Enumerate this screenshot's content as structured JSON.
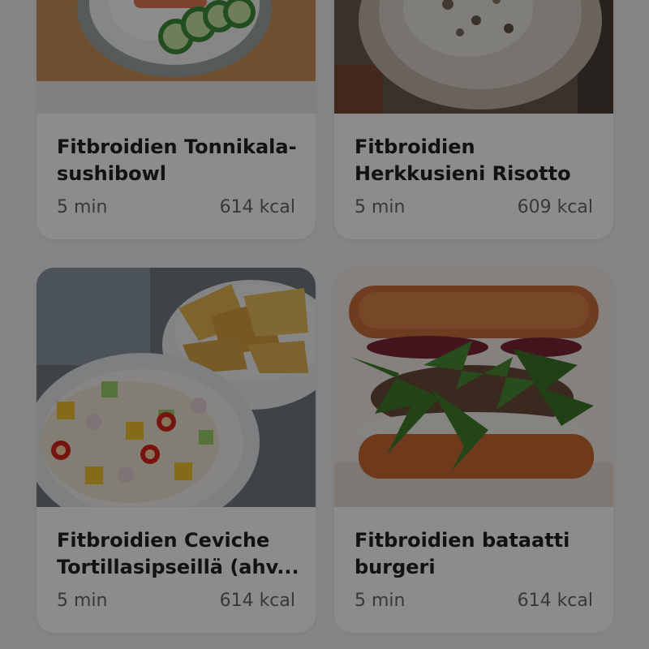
{
  "recipes": [
    {
      "title_line1": "Fitbroidien Tonnikala-",
      "title_line2": "sushibowl",
      "time": "5 min",
      "kcal": "614 kcal"
    },
    {
      "title_line1": "Fitbroidien",
      "title_line2": "Herkkusieni Risotto",
      "time": "5 min",
      "kcal": "609 kcal"
    },
    {
      "title_line1": "Fitbroidien Ceviche",
      "title_line2": "Tortillasipseillä (ahv...",
      "time": "5 min",
      "kcal": "614 kcal"
    },
    {
      "title_line1": "Fitbroidien bataatti",
      "title_line2": "burgeri",
      "time": "5 min",
      "kcal": "614 kcal"
    }
  ],
  "icons": {
    "recipe_1": "sushi-bowl-photo",
    "recipe_2": "mushroom-risotto-photo",
    "recipe_3": "ceviche-with-tortilla-chips-photo",
    "recipe_4": "sweet-potato-burger-photo"
  },
  "colors": {
    "overlay": "#000000",
    "card": "#ffffff",
    "title": "#222222",
    "meta": "#666666"
  }
}
